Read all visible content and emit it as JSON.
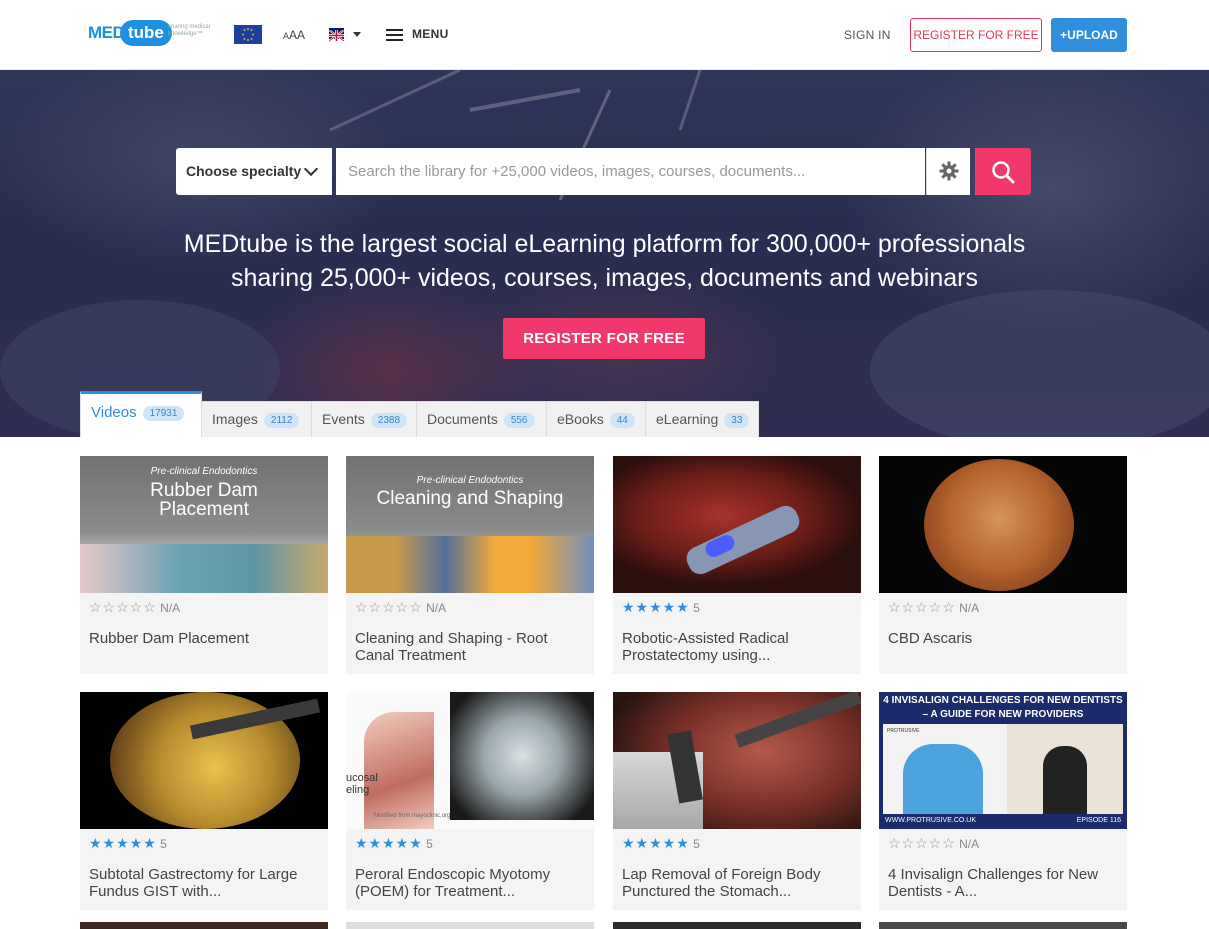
{
  "header": {
    "logo_med": "MED",
    "logo_tube": "tube",
    "logo_tagline": "sharing medical knowledge™",
    "font_size_label_small": "A",
    "font_size_label_large": "AA",
    "menu_label": "MENU",
    "sign_in": "SIGN IN",
    "register_label": "REGISTER FOR FREE",
    "upload_label": "+UPLOAD"
  },
  "hero": {
    "specialty_label": "Choose specialty",
    "search_placeholder": "Search the library for +25,000 videos, images, courses, documents...",
    "line1": "MEDtube is the largest social eLearning platform for 300,000+ professionals",
    "line2": "sharing 25,000+ videos, courses, images, documents and webinars",
    "cta_label": "REGISTER FOR FREE"
  },
  "tabs": [
    {
      "label": "Videos",
      "count": "17931"
    },
    {
      "label": "Images",
      "count": "2112"
    },
    {
      "label": "Events",
      "count": "2388"
    },
    {
      "label": "Documents",
      "count": "556"
    },
    {
      "label": "eBooks",
      "count": "44"
    },
    {
      "label": "eLearning",
      "count": "33"
    }
  ],
  "cards": [
    {
      "title": "Rubber Dam Placement",
      "rating": "N/A",
      "stars": 0,
      "thumb_line1": "Pre-clinical Endodontics",
      "thumb_line2": "Rubber Dam",
      "thumb_line3": "Placement"
    },
    {
      "title": "Cleaning and Shaping - Root Canal Treatment",
      "rating": "N/A",
      "stars": 0,
      "thumb_line1": "Pre-clinical Endodontics",
      "thumb_line2": "Cleaning and Shaping"
    },
    {
      "title": "Robotic-Assisted Radical Prostatectomy using...",
      "rating": "5",
      "stars": 5
    },
    {
      "title": "CBD Ascaris",
      "rating": "N/A",
      "stars": 0
    },
    {
      "title": "Subtotal Gastrectomy for Large Fundus GIST with...",
      "rating": "5",
      "stars": 5
    },
    {
      "title": "Peroral Endoscopic Myotomy (POEM) for Treatment...",
      "rating": "5",
      "stars": 5,
      "thumb_text1": "ucosal",
      "thumb_text2": "eling",
      "thumb_caption": "Modified from mayoclinic.org"
    },
    {
      "title": "Lap Removal of Foreign Body Punctured the Stomach...",
      "rating": "5",
      "stars": 5
    },
    {
      "title": "4 Invisalign Challenges for New Dentists - A...",
      "rating": "N/A",
      "stars": 0,
      "thumb_heading1": "4 INVISALIGN CHALLENGES FOR NEW DENTISTS",
      "thumb_heading2": "– A GUIDE FOR NEW PROVIDERS",
      "thumb_footer_left": "WWW.PROTRUSIVE.CO.UK",
      "thumb_footer_right": "EPISODE 116",
      "thumb_badge": "PROTRUSIVE"
    }
  ],
  "colors": {
    "accent_blue": "#2f8fdd",
    "accent_pink": "#f0386b",
    "star_blue": "#2f8fdd"
  }
}
